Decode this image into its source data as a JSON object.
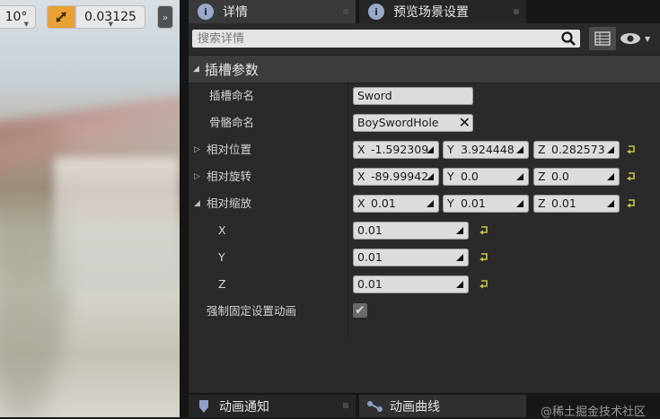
{
  "viewport": {
    "angle_snap": "10°",
    "scale_snap_value": "0.03125",
    "expand_glyph": "»"
  },
  "tabs": [
    {
      "label": "详情",
      "active": true
    },
    {
      "label": "预览场景设置",
      "active": false
    }
  ],
  "search": {
    "placeholder": "搜索详情"
  },
  "category": {
    "title": "插槽参数"
  },
  "rows": {
    "socket_name": {
      "label": "插槽命名",
      "value": "Sword"
    },
    "bone_name": {
      "label": "骨骼命名",
      "value": "BoySwordHole"
    },
    "relative_location": {
      "label": "相对位置",
      "x": "-1.592309",
      "y": "3.924448",
      "z": "0.282573"
    },
    "relative_rotation": {
      "label": "相对旋转",
      "x": "-89.99942",
      "y": "0.0",
      "z": "0.0"
    },
    "relative_scale": {
      "label": "相对缩放",
      "x": "0.01",
      "y": "0.01",
      "z": "0.01"
    },
    "scale_x": {
      "label": "X",
      "value": "0.01"
    },
    "scale_y": {
      "label": "Y",
      "value": "0.01"
    },
    "scale_z": {
      "label": "Z",
      "value": "0.01"
    },
    "force_always_animated": {
      "label": "强制固定设置动画",
      "checked": true
    }
  },
  "axis_letters": {
    "x": "X",
    "y": "Y",
    "z": "Z"
  },
  "bottom_tabs": [
    {
      "label": "动画通知"
    },
    {
      "label": "动画曲线"
    }
  ],
  "watermark": "@稀土掘金技术社区",
  "colors": {
    "panel_bg": "#2a2a2a",
    "field_bg": "#dcdcdc",
    "accent_orange": "#e9a035",
    "reset_arrow": "#c9c34a"
  }
}
